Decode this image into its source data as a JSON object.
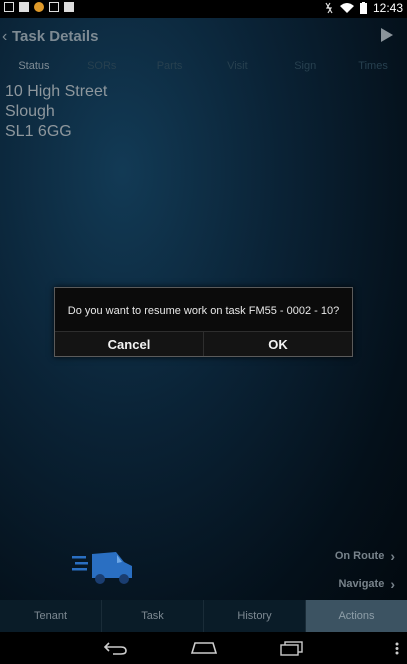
{
  "statusbar": {
    "time": "12:43",
    "icons": [
      "image-icon",
      "mail-icon",
      "app-icon",
      "checklist-icon",
      "clipboard-icon",
      "no-data-icon",
      "wifi-icon",
      "battery-icon"
    ]
  },
  "header": {
    "title": "Task Details"
  },
  "tabs": [
    {
      "label": "Status",
      "active": true
    },
    {
      "label": "SORs",
      "active": false
    },
    {
      "label": "Parts",
      "active": false
    },
    {
      "label": "Visit",
      "active": false
    },
    {
      "label": "Sign",
      "active": false
    },
    {
      "label": "Times",
      "active": false
    }
  ],
  "address": [
    "10 High Street",
    "Slough",
    "SL1 6GG"
  ],
  "dialog": {
    "message": "Do you want to resume work on task FM55 - 0002 - 10?",
    "cancel_label": "Cancel",
    "ok_label": "OK"
  },
  "links": {
    "on_route": "On Route",
    "navigate": "Navigate"
  },
  "bottom_tabs": [
    {
      "label": "Tenant",
      "active": false
    },
    {
      "label": "Task",
      "active": false
    },
    {
      "label": "History",
      "active": false
    },
    {
      "label": "Actions",
      "active": true
    }
  ],
  "colors": {
    "accent_van": "#2a6fc2",
    "active_tab": "#3c5362"
  }
}
